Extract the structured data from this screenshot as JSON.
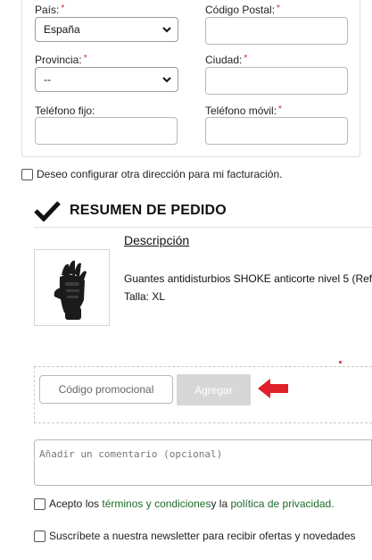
{
  "address_form": {
    "country": {
      "label": "País:",
      "required_mark": "*",
      "value": "España"
    },
    "postal_code": {
      "label": "Código Postal:",
      "required_mark": "*",
      "value": ""
    },
    "province": {
      "label": "Provincia:",
      "required_mark": "*",
      "value": "--"
    },
    "city": {
      "label": "Ciudad:",
      "required_mark": "*",
      "value": ""
    },
    "landline": {
      "label": "Teléfono fijo:",
      "value": ""
    },
    "mobile": {
      "label": "Teléfono móvil:",
      "required_mark": "*",
      "value": ""
    }
  },
  "billing_checkbox": {
    "label": "Deseo configurar otra dirección para mi facturación.",
    "checked": false
  },
  "order_summary": {
    "title": "RESUMEN DE PEDIDO",
    "column_header": "Descripción",
    "items": [
      {
        "name": "Guantes antidisturbios SHOKE anticorte nivel 5 (Ref",
        "size": "Talla: XL"
      }
    ]
  },
  "promo": {
    "placeholder": "Código promocional",
    "button_label": "Agregar"
  },
  "comment": {
    "placeholder": "Añadir un comentario (opcional)"
  },
  "terms": {
    "prefix": "Acepto los ",
    "terms_link": "términos y condiciones",
    "middle": " y la ",
    "privacy_link": "política de privacidad",
    "suffix": ".",
    "checked": false
  },
  "newsletter": {
    "label": "Suscríbete a nuestra newsletter para recibir ofertas y novedades",
    "checked": false
  },
  "colors": {
    "required": "#d9262b",
    "link": "#1e6b2a",
    "button_disabled": "#d7d7d7",
    "arrow": "#e0202a"
  },
  "icons": {
    "summary": "checkmark-icon",
    "select": "chevron-down-icon",
    "annotation": "left-arrow-icon"
  }
}
